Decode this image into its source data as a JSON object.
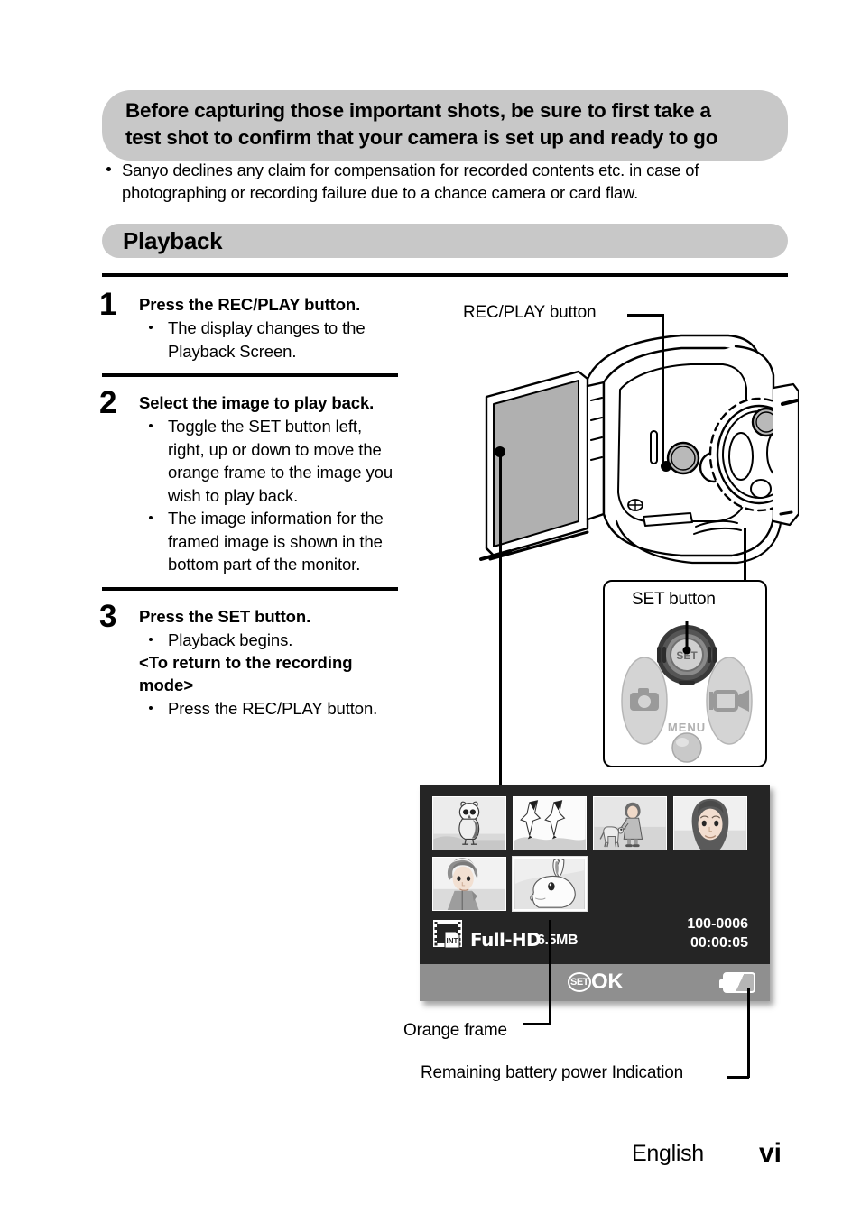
{
  "notice": {
    "title_line1": "Before capturing those important shots, be sure to first take a",
    "title_line2": "test shot to confirm that your camera is set up and ready to go",
    "bullet": "Sanyo declines any claim for compensation for recorded contents etc. in case of photographing or recording failure due to a chance camera or card flaw."
  },
  "section": {
    "title": "Playback"
  },
  "steps": [
    {
      "number": "1",
      "heading": "Press the REC/PLAY button.",
      "bullets": [
        "The display changes to the Playback Screen."
      ]
    },
    {
      "number": "2",
      "heading": "Select the image to play back.",
      "bullets": [
        "Toggle the SET button left, right, up or down to move the orange frame to the image you wish to play back.",
        "The image information for the framed image is shown in the bottom part of the monitor."
      ]
    },
    {
      "number": "3",
      "heading": "Press the SET button.",
      "bullets": [
        "Playback begins."
      ],
      "subheading": "<To return to the recording mode>",
      "bullets2": [
        "Press the REC/PLAY button."
      ]
    }
  ],
  "callouts": {
    "rec_play_button": "REC/PLAY button",
    "set_button": "SET button",
    "orange_frame": "Orange frame",
    "battery": "Remaining battery power Indication"
  },
  "monitor": {
    "thumbnails_row1": [
      "owl",
      "seagulls",
      "girl-with-dog",
      "woman-portrait"
    ],
    "thumbnails_row2": [
      "person-with-bun",
      "rabbit"
    ],
    "selected_thumbnail": "rabbit",
    "quality": "Full-HD",
    "file_size": "6.5MB",
    "file_number": "100-0006",
    "duration": "00:00:05",
    "set_chip": "SET",
    "ok_label": "OK",
    "media_badge": "INT"
  },
  "footer": {
    "language": "English",
    "page": "vi"
  },
  "colors": {
    "banner_gray": "#c8c8c8",
    "monitor_bg": "#252525",
    "ok_bar": "#8f8f8f",
    "lcd_gray": "#b0b0b0"
  }
}
